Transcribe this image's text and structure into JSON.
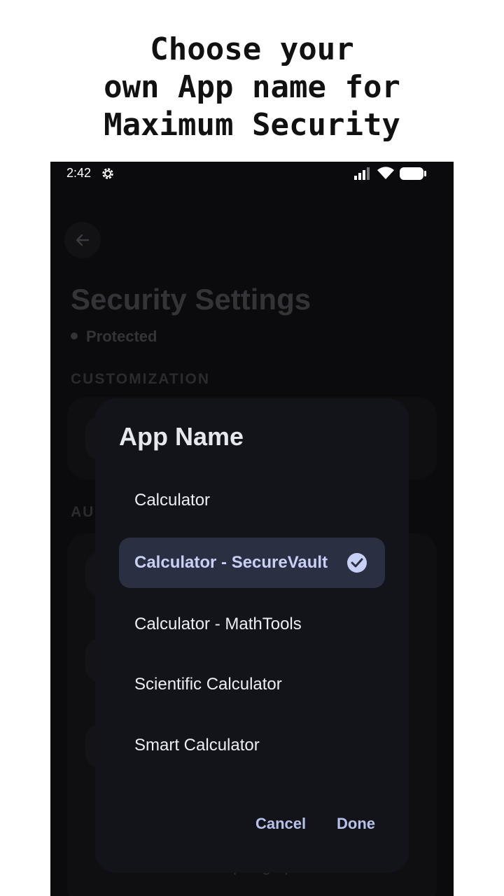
{
  "headline": "Choose your\nown App name for\nMaximum Security",
  "status_bar": {
    "time": "2:42"
  },
  "screen": {
    "title": "Security Settings",
    "status": "Protected",
    "section_customization": "CUSTOMIZATION",
    "section_auth_partial": "AU",
    "notice_line2": "Please set up fingerprint o..."
  },
  "dialog": {
    "title": "App Name",
    "options": [
      {
        "label": "Calculator",
        "selected": false
      },
      {
        "label": "Calculator - SecureVault",
        "selected": true
      },
      {
        "label": "Calculator - MathTools",
        "selected": false
      },
      {
        "label": "Scientific Calculator",
        "selected": false
      },
      {
        "label": "Smart Calculator",
        "selected": false
      }
    ],
    "cancel_label": "Cancel",
    "done_label": "Done"
  },
  "colors": {
    "accent": "#c8d1f5",
    "dialog_bg": "#121419",
    "selected_bg": "#2a2f42"
  }
}
